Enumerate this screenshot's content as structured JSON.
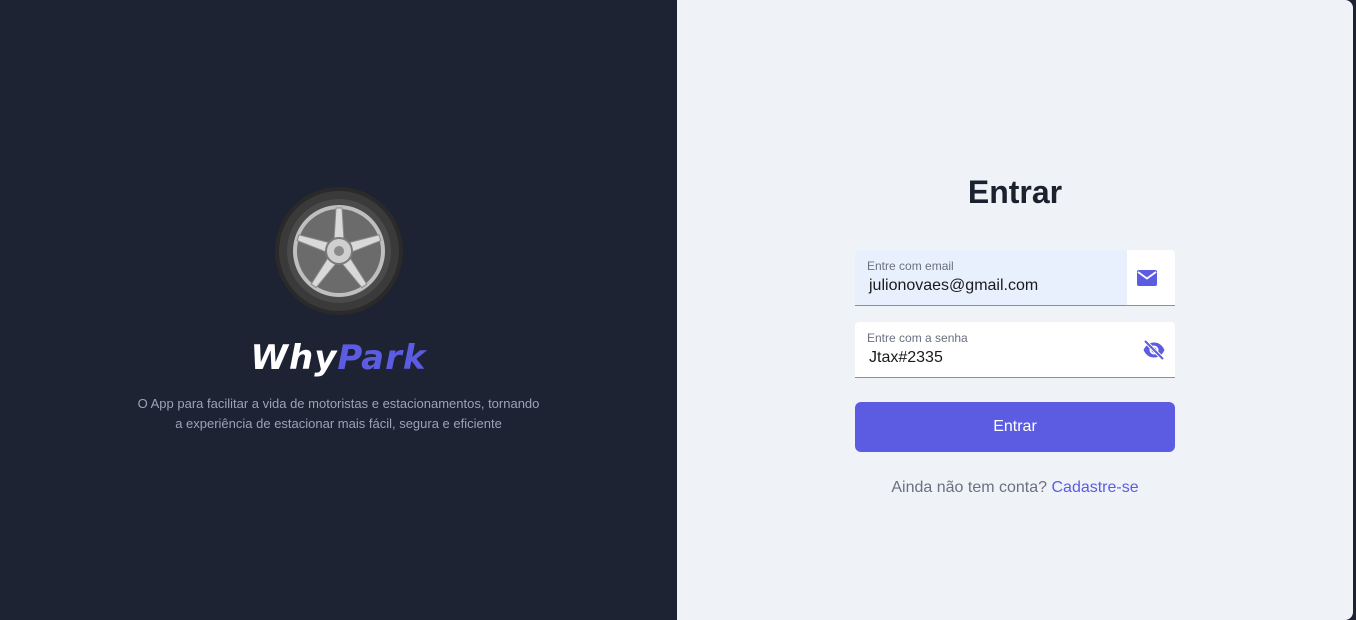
{
  "brand": {
    "name_part1": "Why",
    "name_part2": "Park",
    "tagline_line1": "O App para facilitar a vida de motoristas e estacionamentos, tornando",
    "tagline_line2": "a experiência de estacionar mais fácil, segura e eficiente",
    "logo_icon": "car-wheel-icon"
  },
  "login": {
    "title": "Entrar",
    "email": {
      "label": "Entre com email",
      "value": "julionovaes@gmail.com",
      "icon": "mail-icon"
    },
    "password": {
      "label": "Entre com a senha",
      "value": "Jtax#2335",
      "icon": "eye-off-icon"
    },
    "submit_label": "Entrar",
    "signup_prompt": "Ainda não tem conta?",
    "signup_link": "Cadastre-se"
  },
  "colors": {
    "accent": "#5c5ce3",
    "dark_panel": "#1e2333",
    "light_panel": "#eff3f8"
  }
}
